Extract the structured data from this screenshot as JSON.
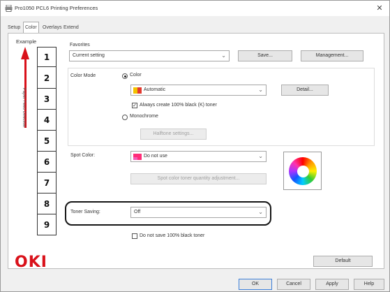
{
  "window": {
    "title": "Pro1050 PCL6 Printing Preferences",
    "close_glyph": "✕"
  },
  "tabs": [
    {
      "label": "Setup"
    },
    {
      "label": "Color"
    },
    {
      "label": "Overlays"
    },
    {
      "label": "Extend"
    }
  ],
  "example": {
    "label": "Example",
    "numbers": [
      "1",
      "2",
      "3",
      "4",
      "5",
      "6",
      "7",
      "8",
      "9"
    ],
    "feed_direction": "Paper Feed Direction",
    "arrow_color": "#d9111a"
  },
  "favorites": {
    "label": "Favorites",
    "value": "Current setting",
    "save_button": "Save...",
    "management_button": "Management..."
  },
  "color_mode": {
    "label": "Color Mode",
    "color_radio": "Color",
    "color_value": "Automatic",
    "detail_button": "Detail...",
    "always_black_checkbox": "Always create 100% black (K) toner",
    "monochrome_radio": "Monochrome",
    "halftone_button": "Halftone settings..."
  },
  "spot_color": {
    "label": "Spot Color:",
    "value": "Do not use",
    "adjust_button": "Spot color toner quantity adjustment..."
  },
  "toner_saving": {
    "label": "Toner Saving:",
    "value": "Off",
    "no_black_checkbox": "Do not save 100% black toner"
  },
  "logo": "OKI",
  "buttons": {
    "default": "Default",
    "ok": "OK",
    "cancel": "Cancel",
    "apply": "Apply",
    "help": "Help"
  },
  "icons": {
    "printer": "printer-icon",
    "color_swatch": "color-swatch-icon",
    "chevron": "chevron-down-icon"
  },
  "colors": {
    "oki_red": "#d9111a",
    "highlight": "#151515"
  }
}
